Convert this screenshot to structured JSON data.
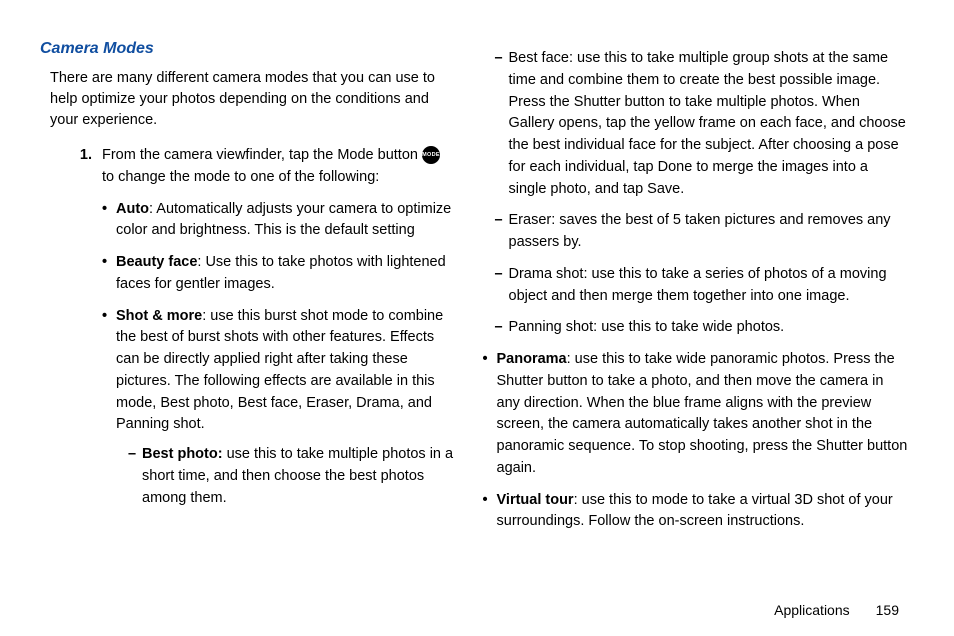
{
  "heading": "Camera Modes",
  "intro": "There are many different camera modes that you can use to help optimize your photos depending on the conditions and your experience.",
  "step1_a": "From the camera viewfinder, tap the Mode button ",
  "step1_b": " to change the mode to one of the following:",
  "mode_badge": "MODE",
  "left_bullets": [
    {
      "term": "Auto",
      "desc": ": Automatically adjusts your camera to optimize color and brightness. This is the default setting"
    },
    {
      "term": "Beauty face",
      "desc": ": Use this to take photos with lightened faces for gentler images."
    },
    {
      "term": "Shot & more",
      "desc": ": use this burst shot mode to combine the best of burst shots with other features. Effects can be directly applied right after taking these pictures. The following effects are available in this mode, Best photo, Best face, Eraser, Drama, and Panning shot."
    }
  ],
  "left_dashes": [
    {
      "term": "Best photo:",
      "desc": " use this to take multiple photos in a short time, and then choose the best photos among them."
    }
  ],
  "right_dashes": [
    {
      "term": "Best face",
      "desc": ": use this to take multiple group shots at the same time and combine them to create the best possible image. Press the Shutter button to take multiple photos. When Gallery opens, tap the yellow frame on each face, and choose the best individual face for the subject. After choosing a pose for each individual, tap Done to merge the images into a single photo, and tap Save."
    },
    {
      "term": "Eraser",
      "desc": ": saves the best of 5 taken pictures and removes any passers by."
    },
    {
      "term": "Drama shot",
      "desc": ": use this to take a series of photos of a moving object and then merge them together into one image."
    },
    {
      "term": "Panning shot",
      "desc": ": use this to take wide photos."
    }
  ],
  "right_bullets": [
    {
      "term": "Panorama",
      "desc": ": use this to take wide panoramic photos. Press the Shutter button to take a photo, and then move the camera in any direction. When the blue frame aligns with the preview screen, the camera automatically takes another shot in the panoramic sequence. To stop shooting, press the Shutter button again."
    },
    {
      "term": "Virtual tour",
      "desc": ": use this to mode to take a virtual 3D shot of your surroundings. Follow the on-screen instructions."
    }
  ],
  "footer": {
    "section": "Applications",
    "page": "159"
  }
}
